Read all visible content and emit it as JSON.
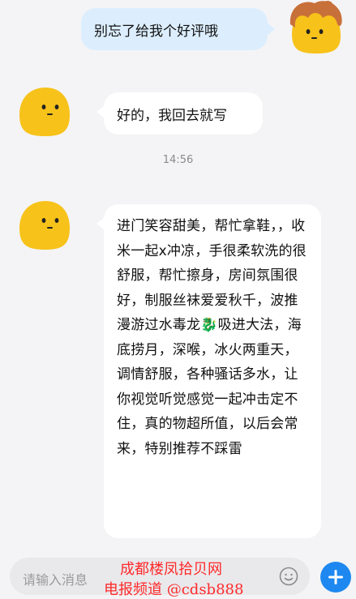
{
  "messages": {
    "outgoing_1": "别忘了给我个好评哦",
    "incoming_1": "好的，我回去就写",
    "timestamp": "14:56",
    "incoming_2": "进门笑容甜美，帮忙拿鞋，，收米一起x冲凉，手很柔软洗的很舒服，帮忙擦身，房间氛围很好，制服丝袜爱爱秋千，波推漫游过水毒龙🐉吸进大法，海底捞月，深喉，冰火两重天，调情舒服，各种骚话多水，让你视觉听觉感觉一起冲击定不住，真的物超所值，以后会常来，特别推荐不踩雷"
  },
  "input": {
    "placeholder": "请输入消息"
  },
  "watermark": {
    "line1": "成都楼凤拾贝网",
    "line2": "电报频道 @cdsb888"
  },
  "icons": {
    "avatar_self": "yellow-blob-avatar-with-hair",
    "avatar_other": "yellow-blob-avatar",
    "emoji": "smiley-icon",
    "add": "plus-icon"
  },
  "colors": {
    "outgoing_bubble": "#dceefe",
    "incoming_bubble": "#ffffff",
    "send_button": "#1e88f0",
    "watermark": "#ff2a2a"
  }
}
